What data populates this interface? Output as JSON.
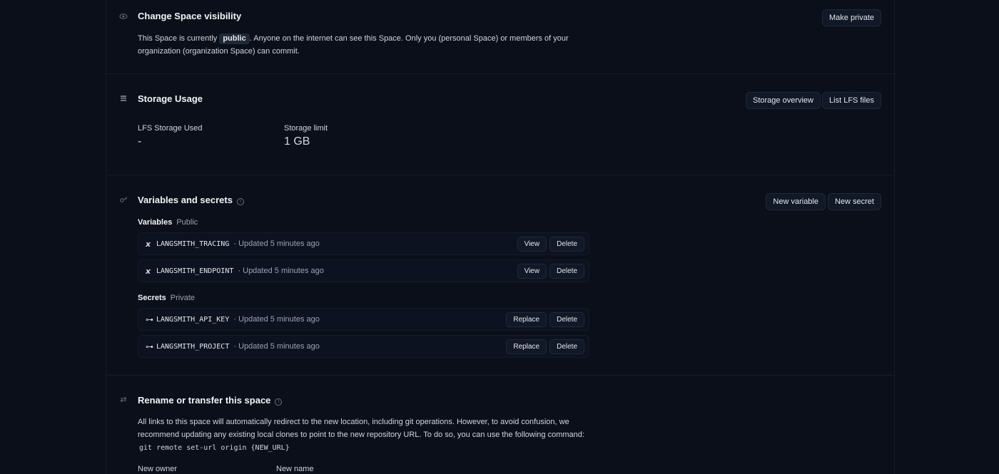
{
  "visibility": {
    "title": "Change Space visibility",
    "text_before": "This Space is currently",
    "status": "public",
    "text_after": ". Anyone on the internet can see this Space. Only you (personal Space) or members of your",
    "text_line2": "organization (organization Space) can commit.",
    "button": "Make private"
  },
  "storage": {
    "title": "Storage Usage",
    "buttons": {
      "overview": "Storage overview",
      "list_lfs": "List LFS files"
    },
    "used_label": "LFS Storage Used",
    "used_value": "-",
    "limit_label": "Storage limit",
    "limit_value": "1 GB"
  },
  "vars": {
    "title": "Variables and secrets",
    "buttons": {
      "new_variable": "New variable",
      "new_secret": "New secret"
    },
    "variables_label": "Variables",
    "variables_scope": "Public",
    "variables": [
      {
        "name": "LANGSMITH_TRACING",
        "meta": "· Updated 5 minutes ago",
        "action1": "View",
        "action2": "Delete"
      },
      {
        "name": "LANGSMITH_ENDPOINT",
        "meta": "· Updated 5 minutes ago",
        "action1": "View",
        "action2": "Delete"
      }
    ],
    "secrets_label": "Secrets",
    "secrets_scope": "Private",
    "secrets": [
      {
        "name": "LANGSMITH_API_KEY",
        "meta": "· Updated 5 minutes ago",
        "action1": "Replace",
        "action2": "Delete"
      },
      {
        "name": "LANGSMITH_PROJECT",
        "meta": "· Updated 5 minutes ago",
        "action1": "Replace",
        "action2": "Delete"
      }
    ]
  },
  "rename": {
    "title": "Rename or transfer this space",
    "line1": "All links to this space will automatically redirect to the new location, including git operations. However, to avoid confusion, we",
    "line2": "recommend updating any existing local clones to point to the new repository URL. To do so, you can use the following command:",
    "command": "git remote set-url origin {NEW_URL}",
    "new_owner_label": "New owner",
    "new_name_label": "New name"
  },
  "icons": {
    "visibility": "eye-icon",
    "storage": "storage-icon",
    "vars": "key-cog-icon",
    "variable": "variable-x-icon",
    "secret": "key-icon",
    "rename": "transfer-arrows-icon",
    "info": "info-icon"
  }
}
